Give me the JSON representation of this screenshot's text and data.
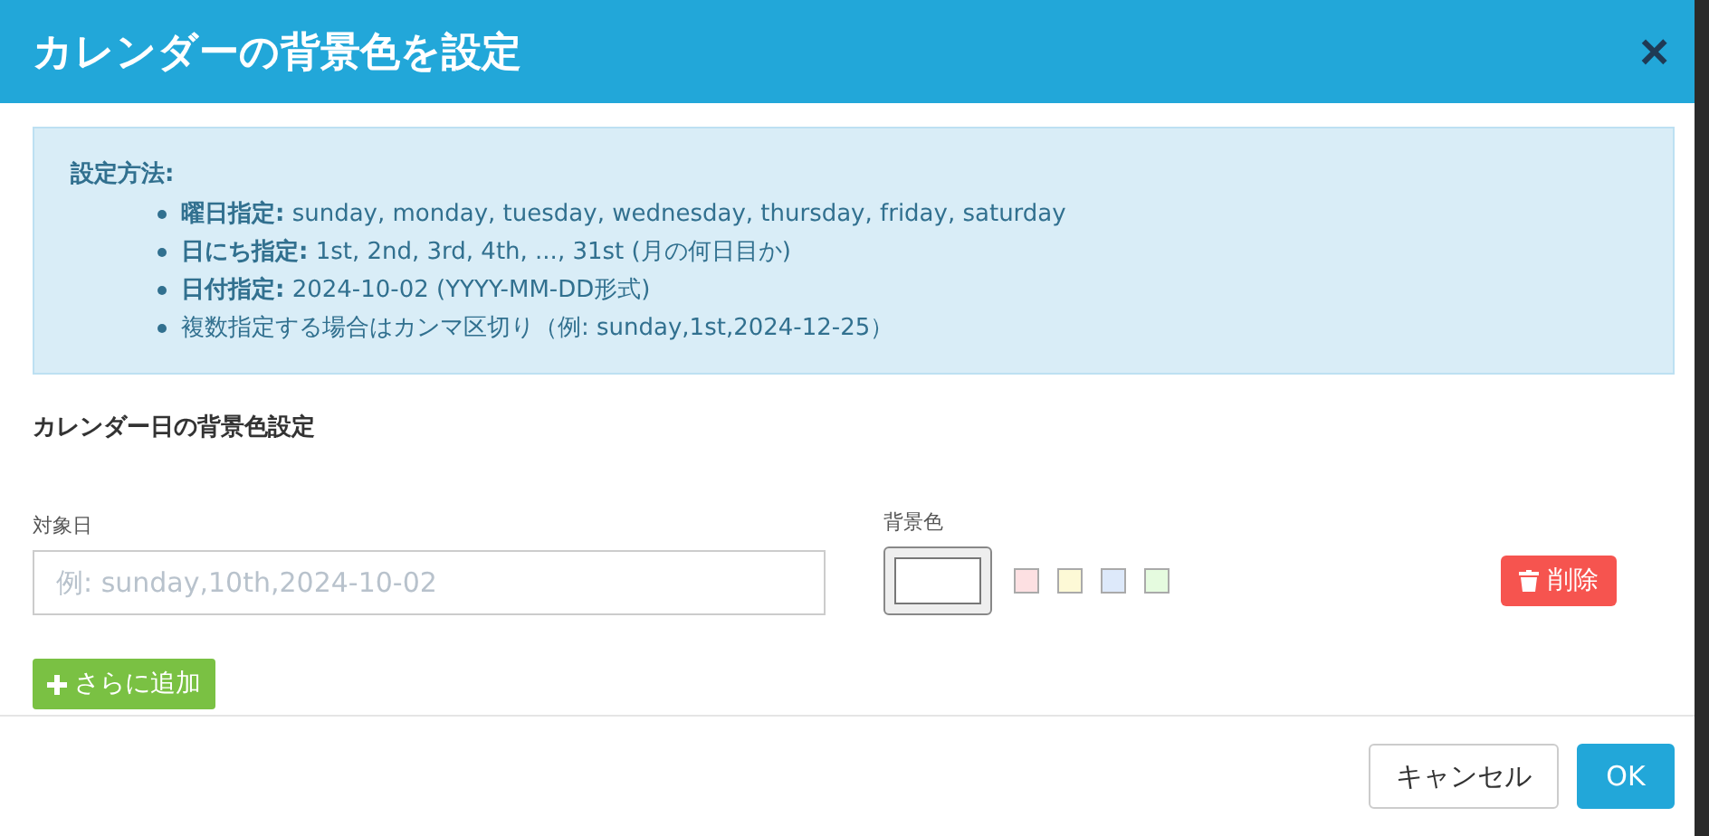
{
  "dialog": {
    "title": "カレンダーの背景色を設定",
    "close": "×"
  },
  "help": {
    "heading": "設定方法:",
    "items": [
      "**曜日指定:** sunday, monday, tuesday, wednesday, thursday, friday, saturday",
      "**日にち指定:** 1st, 2nd, 3rd, 4th, ..., 31st (月の何日目か)",
      "**日付指定:** 2024-10-02 (YYYY-MM-DD形式)",
      "複数指定する場合はカンマ区切り（例: sunday,1st,2024-12-25）"
    ]
  },
  "section_title": "カレンダー日の背景色設定",
  "rows": [
    {
      "date_label": "対象日",
      "date_placeholder": "例: sunday,10th,2024-10-02",
      "color_label": "背景色",
      "color": "#ffffff",
      "swatches": [
        {
          "color": "#fde0e2"
        },
        {
          "color": "#fdf9d6"
        },
        {
          "color": "#dde9fa"
        },
        {
          "color": "#e5fbdf"
        }
      ],
      "delete": "削除"
    }
  ],
  "add_button": "さらに追加",
  "buttons": [
    {
      "label": "キャンセル",
      "kind": "secondary"
    },
    {
      "label": "OK",
      "kind": "primary"
    }
  ]
}
